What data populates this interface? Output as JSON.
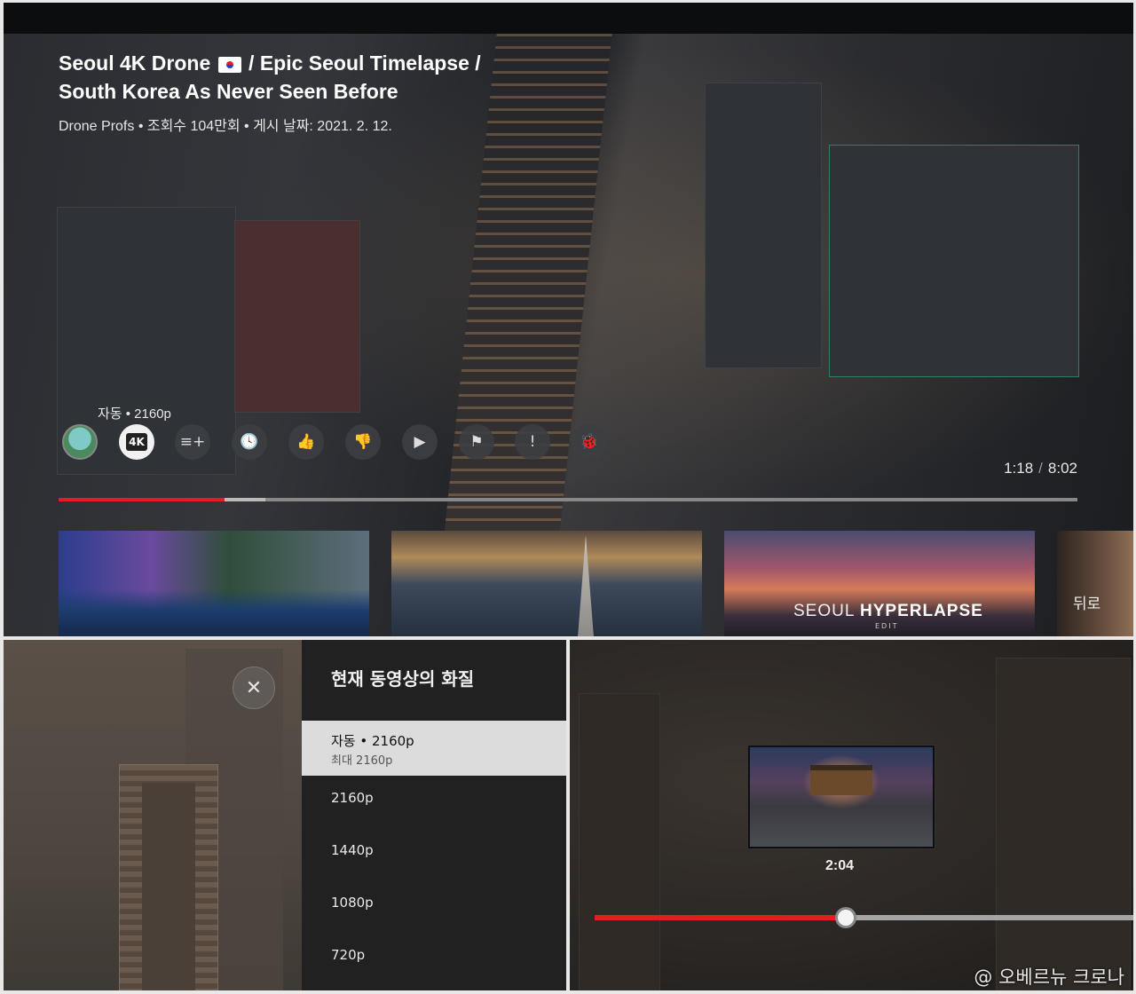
{
  "top": {
    "title_line1_prefix": "Seoul 4K Drone",
    "title_line1_suffix": "/ Epic Seoul Timelapse /",
    "title_line2": "South Korea As Never Seen Before",
    "meta": "Drone Profs • 조회수 104만회 • 게시 날짜: 2021. 2. 12.",
    "quality_label": "자동 • 2160p",
    "controls": [
      {
        "name": "channel-avatar",
        "icon": "avatar"
      },
      {
        "name": "quality-4k-button",
        "icon": "4K"
      },
      {
        "name": "add-to-playlist-button",
        "icon": "≡+"
      },
      {
        "name": "watch-later-button",
        "icon": "🕓"
      },
      {
        "name": "like-button",
        "icon": "👍"
      },
      {
        "name": "dislike-button",
        "icon": "👎"
      },
      {
        "name": "youtube-button",
        "icon": "▶"
      },
      {
        "name": "report-button",
        "icon": "⚑"
      },
      {
        "name": "feedback-button",
        "icon": "!"
      },
      {
        "name": "debug-button",
        "icon": "🐞"
      }
    ],
    "time_current": "1:18",
    "time_sep": "/",
    "time_total": "8:02",
    "progress_played": 0.163,
    "progress_buffered": 0.203,
    "thumb3_overlay_light": "SEOUL",
    "thumb3_overlay_bold": "HYPERLAPSE",
    "thumb3_overlay_sub": "EDIT",
    "back_label": "뒤로"
  },
  "quality_menu": {
    "title": "현재 동영상의 화질",
    "close_icon": "✕",
    "options": [
      {
        "label": "자동 • 2160p",
        "sub": "최대 2160p",
        "selected": true
      },
      {
        "label": "2160p"
      },
      {
        "label": "1440p"
      },
      {
        "label": "1080p"
      },
      {
        "label": "720p"
      }
    ]
  },
  "scrub": {
    "preview_time": "2:04",
    "progress": 0.466
  },
  "watermark": "@ 오베르뉴 크로나",
  "colors": {
    "progress_red": "#e41e1e",
    "menu_bg": "#212121",
    "selected_bg": "#dcdcdc"
  }
}
